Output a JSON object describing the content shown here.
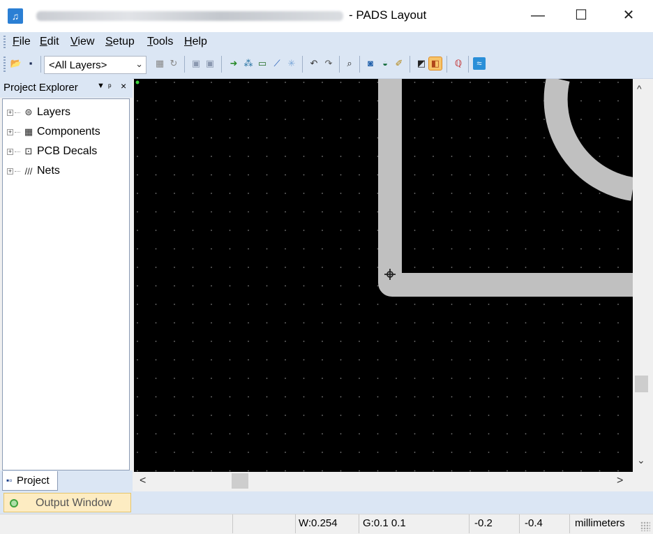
{
  "window": {
    "title": "- PADS Layout",
    "app_icon": "pads-app-icon",
    "controls": {
      "minimize": "—",
      "maximize": "☐",
      "close": "✕"
    }
  },
  "menubar": {
    "items": [
      "File",
      "Edit",
      "View",
      "Setup",
      "Tools",
      "Help"
    ]
  },
  "toolbar": {
    "layer_selector": {
      "value": "<All Layers>",
      "arrow": "⌄"
    }
  },
  "project_explorer": {
    "title": "Project Explorer",
    "header_controls": {
      "dropdown": "▼",
      "pin": "ᵖ",
      "close": "×"
    },
    "tree": [
      {
        "label": "Layers",
        "icon": "layers-icon"
      },
      {
        "label": "Components",
        "icon": "component-chip-icon"
      },
      {
        "label": "PCB Decals",
        "icon": "pcb-decal-icon"
      },
      {
        "label": "Nets",
        "icon": "nets-icon"
      }
    ],
    "tab_label": "Project"
  },
  "scrollbars": {
    "vertical": {
      "up": "^",
      "down": "⌄"
    },
    "horizontal": {
      "left": "<",
      "right": ">"
    }
  },
  "output_window": {
    "label": "Output Window"
  },
  "status_bar": {
    "width": "W:0.254",
    "grid": "G:0.1 0.1",
    "x": "-0.2",
    "y": "-0.4",
    "units": "millimeters"
  },
  "colors": {
    "canvas_bg": "#000000",
    "trace": "#c0c0c0",
    "grid_dot": "#7a7a7a",
    "chrome_bg": "#dbe6f4",
    "output_tab_bg": "#fdecc2"
  }
}
